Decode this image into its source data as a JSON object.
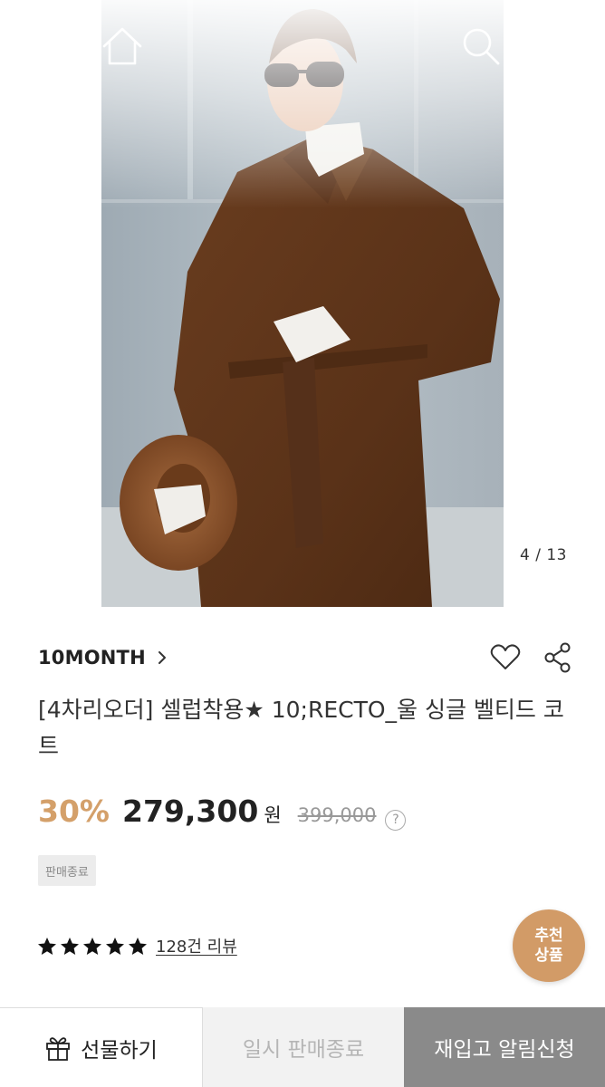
{
  "header": {
    "back_icon": "chevron-left-icon",
    "home_icon": "home-icon",
    "search_icon": "search-icon",
    "cart_icon": "shopping-bag-icon"
  },
  "gallery": {
    "counter": "4 / 13",
    "current": 4,
    "total": 13
  },
  "product": {
    "brand": "10MONTH",
    "title": "[4차리오더] 셀럽착용★ 10;RECTO_울 싱글 벨티드 코트",
    "discount": "30%",
    "price": "279,300",
    "currency": "원",
    "original_price": "399,000",
    "help_label": "?",
    "status_badge": "판매종료",
    "rating": 5,
    "review_link": "128건 리뷰"
  },
  "recommend": {
    "line1": "추천",
    "line2": "상품"
  },
  "bottom_bar": {
    "gift_label": "선물하기",
    "temp_soldout_label": "일시 판매종료",
    "restock_label": "재입고 알림신청"
  },
  "colors": {
    "accent": "#d4a06a",
    "reco_bg": "#d29b67",
    "restock_bg": "#8a8a8a"
  }
}
